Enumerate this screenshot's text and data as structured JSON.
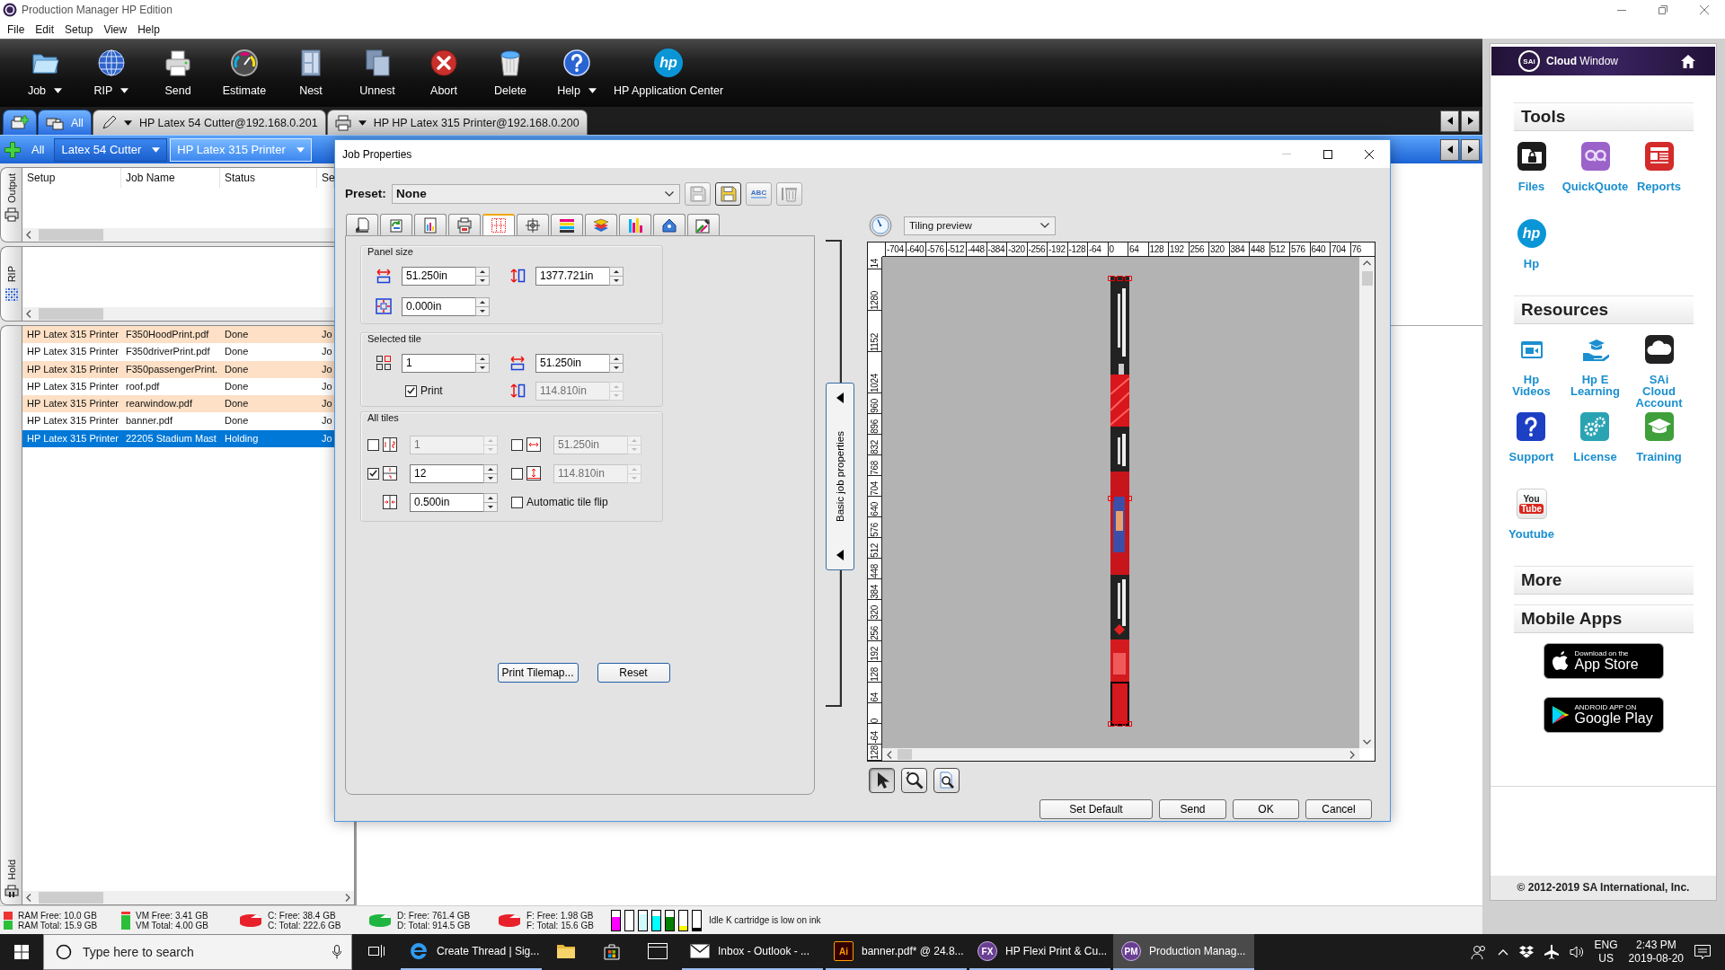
{
  "window": {
    "title": "Production Manager HP Edition"
  },
  "menu": [
    "File",
    "Edit",
    "Setup",
    "View",
    "Help"
  ],
  "toolbar": [
    {
      "kind": "job",
      "label": "Job",
      "dropdown": true
    },
    {
      "kind": "rip",
      "label": "RIP",
      "dropdown": true
    },
    {
      "kind": "send",
      "label": "Send",
      "dropdown": false
    },
    {
      "kind": "estimate",
      "label": "Estimate",
      "dropdown": false
    },
    {
      "kind": "nest",
      "label": "Nest",
      "dropdown": false
    },
    {
      "kind": "unnest",
      "label": "Unnest",
      "dropdown": false
    },
    {
      "kind": "abort",
      "label": "Abort",
      "dropdown": false
    },
    {
      "kind": "delete",
      "label": "Delete",
      "dropdown": false
    },
    {
      "kind": "help",
      "label": "Help",
      "dropdown": true
    },
    {
      "kind": "app-center",
      "label": "HP Application Center",
      "dropdown": false,
      "logo": "hp"
    }
  ],
  "device_tabs": [
    {
      "kind": "add",
      "dropdown": false
    },
    {
      "kind": "all",
      "label": "All",
      "dropdown": false
    },
    {
      "kind": "cutter",
      "label": "HP Latex 54 Cutter@192.168.0.201",
      "dropdown": true
    },
    {
      "kind": "printer",
      "label": "HP HP Latex 315 Printer@192.168.0.200",
      "dropdown": true
    }
  ],
  "filters": [
    {
      "label": "All",
      "selected": false,
      "dropdown": false
    },
    {
      "label": "Latex 54 Cutter",
      "selected": false,
      "dropdown": true
    },
    {
      "label": "HP Latex 315 Printer",
      "selected": true,
      "dropdown": true
    }
  ],
  "queues": [
    {
      "kind": "output",
      "label": "Output"
    },
    {
      "kind": "rip",
      "label": "RIP"
    },
    {
      "kind": "hold",
      "label": "Hold"
    }
  ],
  "job_table": {
    "columns": [
      "Setup",
      "Job Name",
      "Status",
      "Se"
    ],
    "rows": [
      {
        "cells": [
          "HP Latex 315 Printer",
          "F350HoodPrint.pdf",
          "Done",
          "Jo"
        ],
        "selected": false
      },
      {
        "cells": [
          "HP Latex 315 Printer",
          "F350driverPrint.pdf",
          "Done",
          "Jo"
        ],
        "selected": false
      },
      {
        "cells": [
          "HP Latex 315 Printer",
          "F350passengerPrint.",
          "Done",
          "Jo"
        ],
        "selected": false
      },
      {
        "cells": [
          "HP Latex 315 Printer",
          "roof.pdf",
          "Done",
          "Jo"
        ],
        "selected": false
      },
      {
        "cells": [
          "HP Latex 315 Printer",
          "rearwindow.pdf",
          "Done",
          "Jo"
        ],
        "selected": false
      },
      {
        "cells": [
          "HP Latex 315 Printer",
          "banner.pdf",
          "Done",
          "Jo"
        ],
        "selected": false
      },
      {
        "cells": [
          "HP Latex 315 Printer",
          "22205 Stadium Mast",
          "Holding",
          "Jo"
        ],
        "selected": true
      }
    ]
  },
  "dialog": {
    "title": "Job Properties",
    "preset": {
      "label": "Preset:",
      "value": "None"
    },
    "preset_buttons": [
      {
        "kind": "save",
        "disabled": true,
        "focused": false
      },
      {
        "kind": "save-as",
        "disabled": false,
        "focused": true
      },
      {
        "kind": "rename",
        "label": "ABC",
        "disabled": false,
        "focused": false
      },
      {
        "kind": "delete",
        "disabled": true,
        "focused": false
      }
    ],
    "tabs": [
      {
        "kind": "layout",
        "selected": false
      },
      {
        "kind": "transform",
        "selected": false
      },
      {
        "kind": "color",
        "selected": false
      },
      {
        "kind": "printer",
        "selected": false
      },
      {
        "kind": "tiling",
        "selected": true
      },
      {
        "kind": "marks",
        "selected": false
      },
      {
        "kind": "profile",
        "selected": false
      },
      {
        "kind": "layers",
        "selected": false
      },
      {
        "kind": "inks",
        "selected": false
      },
      {
        "kind": "cut",
        "selected": false
      },
      {
        "kind": "picker",
        "selected": false
      }
    ],
    "panel_size": {
      "title": "Panel size",
      "fields": [
        {
          "kind": "width",
          "value": "51.250in",
          "disabled": false
        },
        {
          "kind": "height",
          "value": "1377.721in",
          "disabled": false
        },
        {
          "kind": "overlap",
          "value": "0.000in",
          "disabled": false
        }
      ]
    },
    "selected_tile": {
      "title": "Selected tile",
      "fields": [
        {
          "kind": "tile",
          "value": "1",
          "disabled": false
        },
        {
          "kind": "width",
          "value": "51.250in",
          "disabled": false
        },
        {
          "kind": "checkbox",
          "label": "Print",
          "checked": true
        },
        {
          "kind": "height",
          "value": "114.810in",
          "disabled": true
        }
      ]
    },
    "all_tiles": {
      "title": "All tiles",
      "fields": [
        {
          "kind": "columns",
          "value": "1",
          "checked": false,
          "disabled": true
        },
        {
          "kind": "tile-width",
          "value": "51.250in",
          "checked": false,
          "disabled": true
        },
        {
          "kind": "rows",
          "value": "12",
          "checked": true,
          "disabled": false
        },
        {
          "kind": "tile-height",
          "value": "114.810in",
          "checked": false,
          "disabled": true
        },
        {
          "kind": "gap",
          "value": "0.500in",
          "disabled": false
        },
        {
          "kind": "checkbox",
          "label": "Automatic tile flip",
          "checked": false
        }
      ]
    },
    "panel_buttons": [
      "Print Tilemap...",
      "Reset"
    ],
    "side_tab": "Basic job properties",
    "preview": {
      "mode": "Tiling preview",
      "x_ruler": [
        "-704",
        "-640",
        "-576",
        "-512",
        "-448",
        "-384",
        "-320",
        "-256",
        "-192",
        "-128",
        "-64",
        "0",
        "64",
        "128",
        "192",
        "256",
        "320",
        "384",
        "448",
        "512",
        "576",
        "640",
        "704",
        "76"
      ],
      "y_ruler": [
        "14",
        "1280",
        "1152",
        "1024",
        "960",
        "896",
        "832",
        "768",
        "704",
        "640",
        "576",
        "512",
        "448",
        "384",
        "320",
        "256",
        "192",
        "128",
        "64",
        "0",
        "-64",
        "128"
      ]
    },
    "preview_tools": [
      {
        "kind": "select",
        "selected": true
      },
      {
        "kind": "zoom",
        "selected": false
      },
      {
        "kind": "zoom-page",
        "selected": false
      }
    ],
    "buttons": [
      "Set Default",
      "Send",
      "OK",
      "Cancel"
    ]
  },
  "status_bar": {
    "gauges": [
      {
        "kind": "ram",
        "lines": [
          "RAM Free: 10.0 GB",
          "RAM Total: 15.9 GB"
        ]
      },
      {
        "kind": "vm",
        "lines": [
          "VM Free: 3.41 GB",
          "VM Total: 4.00 GB"
        ]
      },
      {
        "kind": "disk",
        "color": "#e8202a",
        "lines": [
          "C: Free: 38.4 GB",
          "C: Total: 222.6 GB"
        ]
      },
      {
        "kind": "disk",
        "color": "#1fb541",
        "lines": [
          "D: Free: 761.4 GB",
          "D: Total: 914.5 GB"
        ]
      },
      {
        "kind": "disk",
        "color": "#e8202a",
        "lines": [
          "F: Free: 1.98 GB",
          "F: Total: 15.6 GB"
        ]
      }
    ],
    "inks": [
      {
        "color": "#ff00ff",
        "level": 0.65
      },
      {
        "color": "#ffffff",
        "level": 1
      },
      {
        "color": "#d2fafa",
        "level": 0.8
      },
      {
        "color": "#00ffff",
        "level": 0.7
      },
      {
        "color": "#008000",
        "level": 0.65
      },
      {
        "color": "#ffff00",
        "level": 0.2
      },
      {
        "color": "#000000",
        "level": 0.1
      }
    ],
    "message": "Idle K cartridge is low on ink"
  },
  "cloud": {
    "logo": "SAi",
    "title": "**Cloud** Window",
    "sections": [
      {
        "title": "Tools",
        "items": [
          {
            "kind": "files",
            "label": "Files"
          },
          {
            "kind": "quickquote",
            "label": "QuickQuote"
          },
          {
            "kind": "reports",
            "label": "Reports"
          },
          {
            "kind": "hp",
            "label": "Hp",
            "logo": "hp"
          }
        ]
      },
      {
        "title": "Resources",
        "items": [
          {
            "kind": "videos",
            "label": "Hp Videos"
          },
          {
            "kind": "elearning",
            "label": "Hp E Learning"
          },
          {
            "kind": "cloud",
            "label": "SAi Cloud Account"
          },
          {
            "kind": "support",
            "label": "Support"
          },
          {
            "kind": "license",
            "label": "License"
          },
          {
            "kind": "training",
            "label": "Training"
          },
          {
            "kind": "youtube",
            "label": "Youtube",
            "logo": [
              "You",
              "Tube"
            ]
          }
        ]
      },
      {
        "title": "More"
      },
      {
        "title": "Mobile Apps",
        "badges": [
          {
            "kind": "apple",
            "caption": "Download on the",
            "name": "App Store"
          },
          {
            "kind": "google",
            "caption": "ANDROID APP ON",
            "name": "Google Play"
          }
        ]
      }
    ],
    "copyright": "© 2012-2019 SA International, Inc."
  },
  "taskbar": {
    "search": {
      "placeholder": "Type here to search"
    },
    "items": [
      {
        "kind": "task-view",
        "selected": false
      },
      {
        "kind": "browser",
        "label": "Create Thread | Sig...",
        "selected": false
      },
      {
        "kind": "files",
        "selected": false
      },
      {
        "kind": "store",
        "selected": false
      },
      {
        "kind": "window",
        "selected": false
      },
      {
        "kind": "mail",
        "label": "Inbox - Outlook - ...",
        "selected": false
      },
      {
        "kind": "illustrator",
        "label": "banner.pdf* @ 24.8...",
        "badge": "Ai",
        "selected": false
      },
      {
        "kind": "flexi",
        "label": "HP Flexi Print & Cu...",
        "badge": "FX",
        "selected": false
      },
      {
        "kind": "production",
        "label": "Production Manag...",
        "badge": "PM",
        "selected": true
      }
    ],
    "tray": {
      "language": [
        "ENG",
        "US"
      ],
      "time": "2:43 PM",
      "date": "2019-08-20"
    }
  }
}
